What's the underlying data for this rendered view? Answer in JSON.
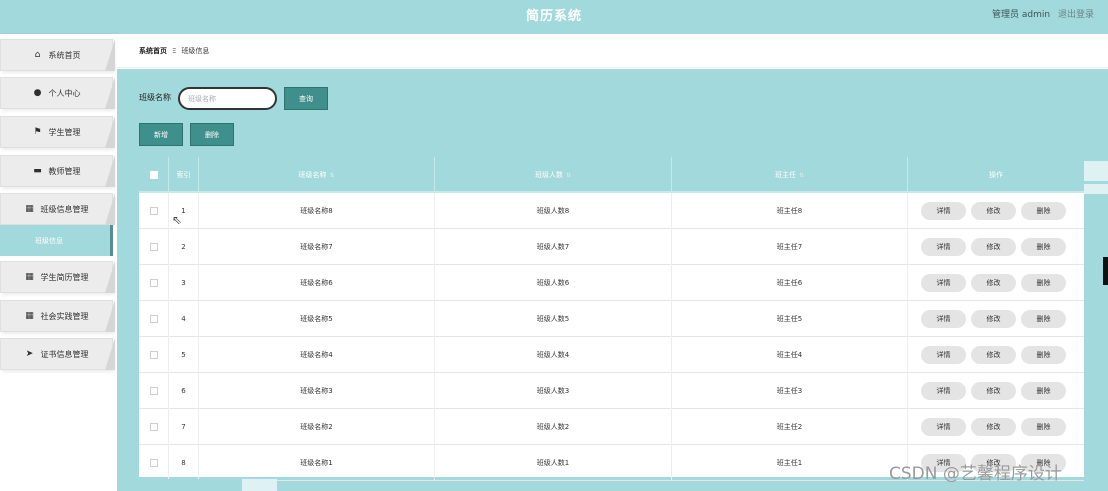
{
  "app": {
    "title": "简历系统",
    "user": "管理员 admin",
    "logout": "退出登录"
  },
  "sidebar": {
    "items": [
      {
        "label": "系统首页",
        "icon": "home-icon"
      },
      {
        "label": "个人中心",
        "icon": "user-icon"
      },
      {
        "label": "学生管理",
        "icon": "flag-icon"
      },
      {
        "label": "教师管理",
        "icon": "chat-icon"
      },
      {
        "label": "班级信息管理",
        "icon": "grid-icon"
      },
      {
        "label": "学生简历管理",
        "icon": "grid-icon"
      },
      {
        "label": "社会实践管理",
        "icon": "grid-icon"
      },
      {
        "label": "证书信息管理",
        "icon": "send-icon"
      }
    ],
    "active_sub": "班级信息"
  },
  "breadcrumb": {
    "home": "系统首页",
    "separator": "Ξ",
    "current": "班级信息"
  },
  "search": {
    "label": "班级名称",
    "placeholder": "班级名称",
    "query_button": "查询"
  },
  "actions": {
    "add": "新增",
    "delete": "删除"
  },
  "table": {
    "headers": {
      "index": "索引",
      "class_name": "班级名称",
      "class_count": "班级人数",
      "head_teacher": "班主任",
      "ops": "操作"
    },
    "rows": [
      {
        "index": "1",
        "name": "班级名称8",
        "count": "班级人数8",
        "teacher": "班主任8"
      },
      {
        "index": "2",
        "name": "班级名称7",
        "count": "班级人数7",
        "teacher": "班主任7"
      },
      {
        "index": "3",
        "name": "班级名称6",
        "count": "班级人数6",
        "teacher": "班主任6"
      },
      {
        "index": "4",
        "name": "班级名称5",
        "count": "班级人数5",
        "teacher": "班主任5"
      },
      {
        "index": "5",
        "name": "班级名称4",
        "count": "班级人数4",
        "teacher": "班主任4"
      },
      {
        "index": "6",
        "name": "班级名称3",
        "count": "班级人数3",
        "teacher": "班主任3"
      },
      {
        "index": "7",
        "name": "班级名称2",
        "count": "班级人数2",
        "teacher": "班主任2"
      },
      {
        "index": "8",
        "name": "班级名称1",
        "count": "班级人数1",
        "teacher": "班主任1"
      }
    ],
    "op_labels": {
      "detail": "详情",
      "edit": "修改",
      "delete": "删除"
    }
  },
  "watermark": "CSDN @艺馨程序设计",
  "colors": {
    "header": "#a2d9dc",
    "button": "#3f8f8c",
    "pill": "#e4e4e4"
  }
}
